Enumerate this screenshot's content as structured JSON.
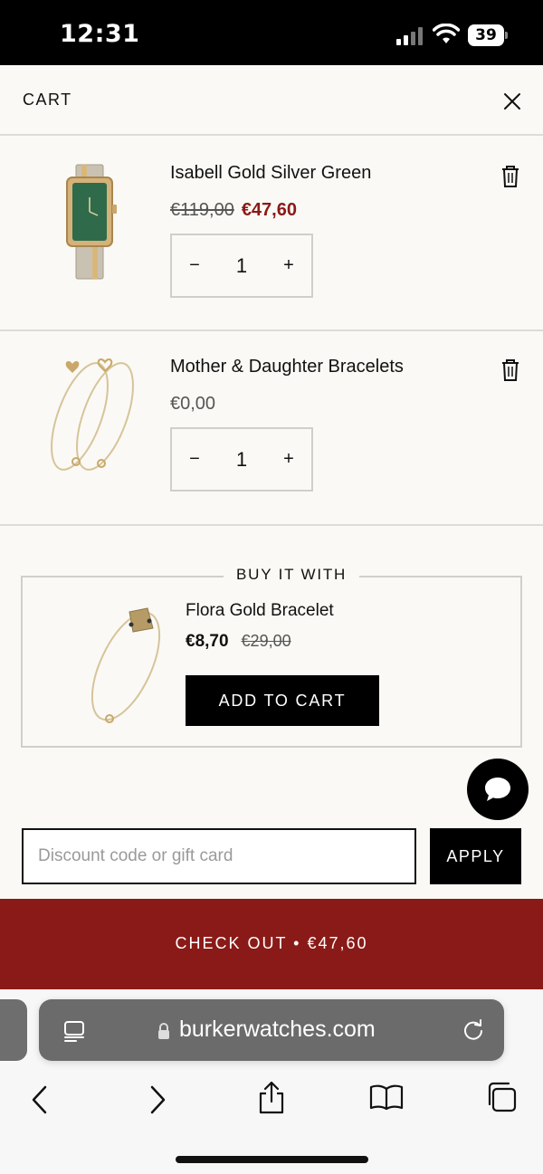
{
  "status": {
    "time": "12:31",
    "battery": "39"
  },
  "cart": {
    "title": "CART",
    "items": [
      {
        "name": "Isabell Gold Silver Green",
        "old_price": "€119,00",
        "price": "€47,60",
        "qty": "1",
        "image": "green-dial-watch"
      },
      {
        "name": "Mother & Daughter Bracelets",
        "price": "€0,00",
        "qty": "1",
        "image": "gold-heart-bracelets"
      }
    ],
    "upsell": {
      "heading": "BUY IT WITH",
      "name": "Flora Gold Bracelet",
      "price": "€8,70",
      "old_price": "€29,00",
      "button": "ADD TO CART",
      "image": "gold-flower-bracelet"
    },
    "discount": {
      "placeholder": "Discount code or gift card",
      "value": "",
      "button": "APPLY"
    },
    "checkout": "CHECK OUT • €47,60"
  },
  "browser": {
    "url": "burkerwatches.com"
  },
  "colors": {
    "accent": "#8a1a17",
    "background": "#faf9f5",
    "button": "#000000"
  }
}
